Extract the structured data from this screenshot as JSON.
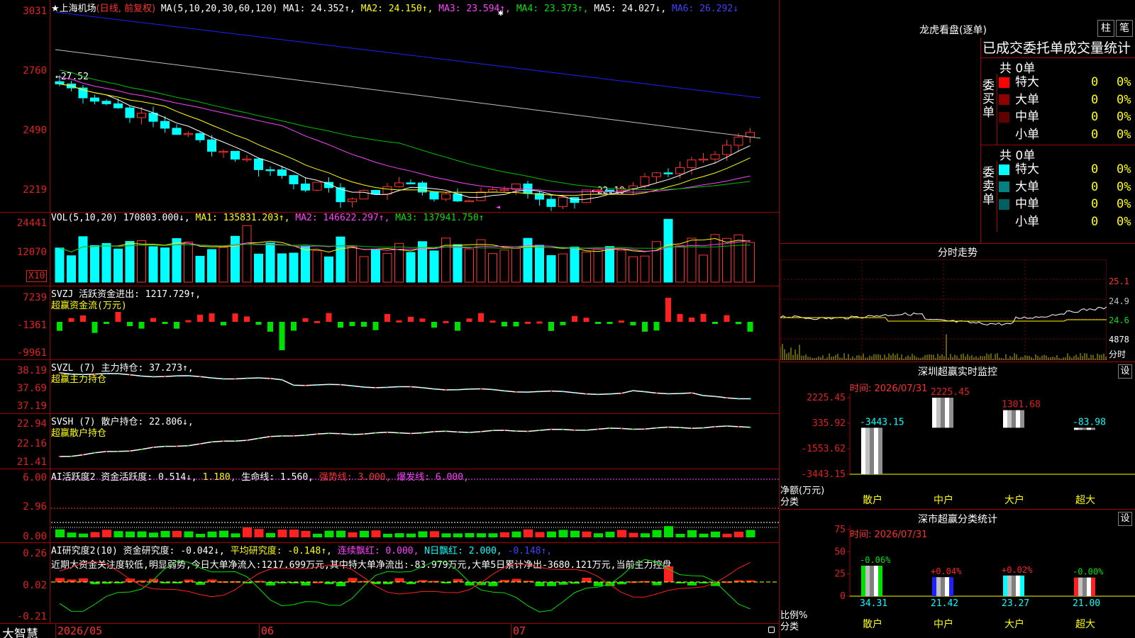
{
  "app": {
    "logo": "大智慧",
    "date_axis": [
      "2026/05",
      "06",
      "07"
    ]
  },
  "kline": {
    "title_prefix": "★上海机场",
    "title_period": "(日线, 前复权)",
    "ma_label": "MA(5,10,20,30,60,120)",
    "ma1": "MA1: 24.352↑,",
    "ma2": "MA2: 24.150↑,",
    "ma3": "MA3: 23.594↑,",
    "ma4": "MA4: 23.373↑,",
    "ma5": "MA5: 24.027↓,",
    "ma6": "MA6: 26.292↓",
    "y_ticks": [
      "3031",
      "2760",
      "2490",
      "2219"
    ],
    "high_note": "←27.52",
    "low_note": "←22.19"
  },
  "vol": {
    "label": "VOL(5,10,20)",
    "value": "170803.000↓,",
    "ma1": "MA1: 135831.203↑,",
    "ma2": "MA2: 146622.297↑,",
    "ma3": "MA3: 137941.750↑",
    "y_ticks": [
      "24441",
      "12070"
    ],
    "unit": "X10"
  },
  "svzj": {
    "label": "SVZJ  活跃资金进出: 1217.729↑,",
    "sub": "超赢资金流(万元)",
    "y_ticks": [
      "7239",
      "-1361",
      "-9961"
    ]
  },
  "svzl": {
    "label": "SVZL (7) 主力持仓: 37.273↑,",
    "sub": "超赢主力持仓",
    "y_ticks": [
      "38.19",
      "37.69",
      "37.19"
    ]
  },
  "svsh": {
    "label": "SVSH (7) 散户持仓: 22.806↓,",
    "sub": "超赢散户持仓",
    "y_ticks": [
      "22.94",
      "22.16",
      "21.41"
    ]
  },
  "ai1": {
    "label": "AI活跃度2 资金活跃度: 0.514↓,",
    "v2": "1.180,",
    "life": "生命线: 1.560,",
    "strong": "强势线: 3.000,",
    "burst": "爆发线: 6.000,",
    "y_ticks": [
      "6.00",
      "2.96",
      "0.00"
    ]
  },
  "ai2": {
    "label": "AI研究度2(10) 资金研究度: -0.042↓,",
    "avg": "平均研究度: -0.148↑,",
    "red": "连续飘红: 0.000,",
    "nred": "N日飘红: 2.000,",
    "last": "-0.148↑,",
    "note": "近期大资金关注度较低,明显弱势,今日大单净流入:1217.699万元,其中特大单净流出:-83.979万元,大单5日累计净出-3680.121万元,当前主力控盘",
    "y_ticks": [
      "0.26",
      "0.02",
      "-0.21"
    ]
  },
  "lhb": {
    "title": "龙虎看盘(逐单)",
    "btn1": "柱",
    "btn2": "笔",
    "header": "已成交委托单成交量统计",
    "buy_total": "共 0单",
    "sell_total": "共 0单",
    "buy_side": "委买单",
    "sell_side": "委卖单",
    "buy_rows": [
      {
        "name": "特大",
        "count": "0",
        "pct": "0%",
        "color": "#ff0000"
      },
      {
        "name": "大单",
        "count": "0",
        "pct": "0%",
        "color": "#900000"
      },
      {
        "name": "中单",
        "count": "0",
        "pct": "0%",
        "color": "#600000"
      },
      {
        "name": "小单",
        "count": "0",
        "pct": "0%",
        "color": ""
      }
    ],
    "sell_rows": [
      {
        "name": "特大",
        "count": "0",
        "pct": "0%",
        "color": "#00ffff"
      },
      {
        "name": "大单",
        "count": "0",
        "pct": "0%",
        "color": "#008080"
      },
      {
        "name": "中单",
        "count": "0",
        "pct": "0%",
        "color": "#006060"
      },
      {
        "name": "小单",
        "count": "0",
        "pct": "0%",
        "color": ""
      }
    ]
  },
  "intraday": {
    "title": "分时走势",
    "prices": [
      "25.1",
      "24.9",
      "24.6"
    ],
    "vol": "4878",
    "unit": "分时"
  },
  "sz_monitor": {
    "title": "深圳超赢实时监控",
    "set": "设",
    "time": "时间: 2026/07/31",
    "y_ticks": [
      "2225.45",
      "335.92",
      "-1553.62",
      "-3443.15"
    ],
    "y_unit": "净额(万元)",
    "x_unit": "分类",
    "categories": [
      "散户",
      "中户",
      "大户",
      "超大"
    ],
    "values": [
      -3443.15,
      2225.45,
      1301.68,
      -83.98
    ],
    "value_labels": [
      "-3443.15",
      "2225.45",
      "1301.68",
      "-83.98"
    ]
  },
  "sz_stats": {
    "title": "深市超赢分类统计",
    "set": "设",
    "time": "时间: 2026/07/31",
    "y_ticks": [
      "75",
      "50",
      "25",
      "0"
    ],
    "y_unit": "比例%",
    "x_unit": "分类",
    "categories": [
      "散户",
      "中户",
      "大户",
      "超大"
    ],
    "values": [
      34.31,
      21.42,
      23.27,
      21.0
    ],
    "value_labels": [
      "34.31",
      "21.42",
      "23.27",
      "21.00"
    ],
    "change_labels": [
      "-0.06%",
      "+0.04%",
      "+0.02%",
      "-0.00%"
    ],
    "colors": [
      "#00e000",
      "#2020ff",
      "#00ffff",
      "#ff2020"
    ]
  }
}
